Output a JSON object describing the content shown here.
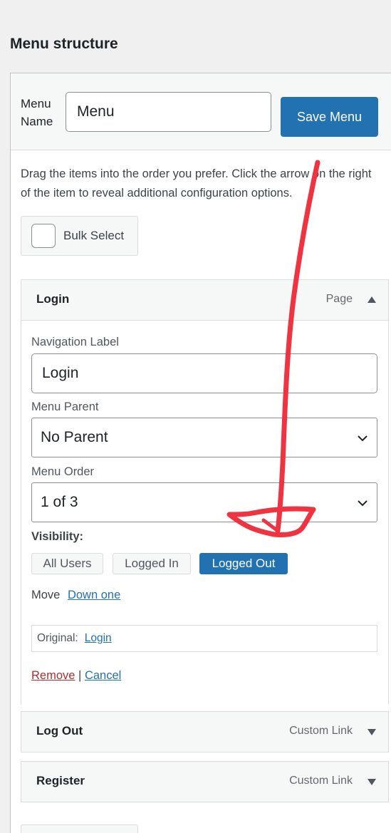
{
  "page_title": "Menu structure",
  "menu_name": {
    "label": "Menu Name",
    "value": "Menu"
  },
  "save_button_label": "Save Menu",
  "instructions": "Drag the items into the order you prefer. Click the arrow on the right of the item to reveal additional configuration options.",
  "bulk_select_label": "Bulk Select",
  "items": [
    {
      "title": "Login",
      "type": "Page",
      "expanded": true,
      "navigation_label_title": "Navigation Label",
      "navigation_label_value": "Login",
      "menu_parent_title": "Menu Parent",
      "menu_parent_value": "No Parent",
      "menu_order_title": "Menu Order",
      "menu_order_value": "1 of 3",
      "visibility_title": "Visibility:",
      "visibility_options": [
        "All Users",
        "Logged In",
        "Logged Out"
      ],
      "visibility_selected": "Logged Out",
      "move_label": "Move",
      "move_link": "Down one",
      "original_label": "Original:",
      "original_link": "Login",
      "remove_label": "Remove",
      "separator": "|",
      "cancel_label": "Cancel"
    },
    {
      "title": "Log Out",
      "type": "Custom Link",
      "expanded": false
    },
    {
      "title": "Register",
      "type": "Custom Link",
      "expanded": false
    }
  ],
  "colors": {
    "primary": "#2271b1",
    "annotation": "#ef3340",
    "remove": "#b32d2e"
  }
}
